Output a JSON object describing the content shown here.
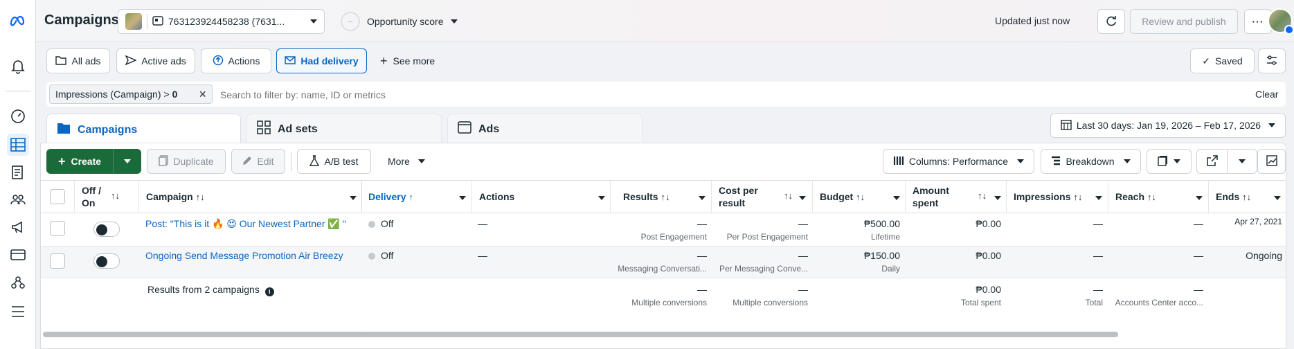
{
  "topbar": {
    "title": "Campaigns",
    "account_id": "763123924458238 (7631...",
    "opportunity_score": "Opportunity score",
    "opportunity_placeholder": "--",
    "updated": "Updated just now",
    "review_publish": "Review and publish"
  },
  "filters": {
    "all_ads": "All ads",
    "active_ads": "Active ads",
    "actions": "Actions",
    "had_delivery": "Had delivery",
    "see_more": "See more",
    "saved": "Saved",
    "chip_label": "Impressions (Campaign) > ",
    "chip_value": "0",
    "search_placeholder": "Search to filter by: name, ID or metrics",
    "clear": "Clear"
  },
  "tabs": {
    "campaigns": "Campaigns",
    "ad_sets": "Ad sets",
    "ads": "Ads",
    "date_range": "Last 30 days: Jan 19, 2026 – Feb 17, 2026"
  },
  "toolbar": {
    "create": "Create",
    "duplicate": "Duplicate",
    "edit": "Edit",
    "ab_test": "A/B test",
    "more": "More",
    "columns": "Columns: Performance",
    "breakdown": "Breakdown"
  },
  "table": {
    "headers": {
      "off_on_1": "Off /",
      "off_on_2": "On",
      "campaign": "Campaign",
      "delivery": "Delivery",
      "actions": "Actions",
      "results": "Results",
      "cpr_1": "Cost per",
      "cpr_2": "result",
      "budget": "Budget",
      "spent_1": "Amount",
      "spent_2": "spent",
      "impressions": "Impressions",
      "reach": "Reach",
      "ends": "Ends"
    },
    "rows": [
      {
        "campaign": "Post: \"This is it 🔥 😍 Our Newest Partner ✅ \"",
        "delivery": "Off",
        "actions": "—",
        "results": "—",
        "results_sub": "Post Engagement",
        "cpr": "—",
        "cpr_sub": "Per Post Engagement",
        "budget": "₱500.00",
        "budget_sub": "Lifetime",
        "spent": "₱0.00",
        "impressions": "—",
        "reach": "—",
        "ends": "Apr 27, 2021"
      },
      {
        "campaign": "Ongoing Send Message Promotion Air Breezy",
        "delivery": "Off",
        "actions": "—",
        "results": "—",
        "results_sub": "Messaging Conversati...",
        "cpr": "—",
        "cpr_sub": "Per Messaging Conve...",
        "budget": "₱150.00",
        "budget_sub": "Daily",
        "spent": "₱0.00",
        "impressions": "—",
        "reach": "—",
        "ends": "Ongoing"
      }
    ],
    "summary": {
      "label": "Results from 2 campaigns",
      "results": "—",
      "results_sub": "Multiple conversions",
      "cpr": "—",
      "cpr_sub": "Multiple conversions",
      "spent": "₱0.00",
      "spent_sub": "Total spent",
      "impressions": "—",
      "impressions_sub": "Total",
      "reach": "—",
      "reach_sub": "Accounts Center acco..."
    }
  },
  "colors": {
    "accent": "#0a66c2",
    "create_green": "#1b6b3a",
    "meta_blue": "#0866ff"
  }
}
